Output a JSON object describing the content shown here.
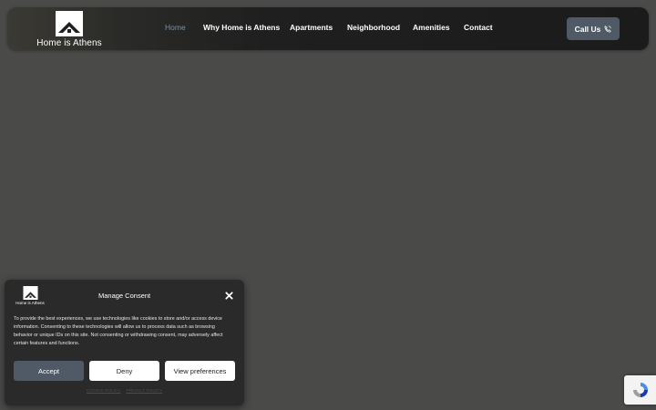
{
  "header": {
    "logo": {
      "icon": "house-logo-icon",
      "text": "Home is Athens"
    },
    "nav": [
      {
        "label": "Home",
        "active": true
      },
      {
        "label": "Why Home is Athens",
        "active": false
      },
      {
        "label": "Apartments",
        "active": false
      },
      {
        "label": "Neighborhood",
        "active": false
      },
      {
        "label": "Amenities",
        "active": false
      },
      {
        "label": "Contact",
        "active": false
      }
    ],
    "call_button": {
      "label": "Call Us",
      "icon": "phone-icon"
    }
  },
  "consent": {
    "logo_text": "Home is Athens",
    "title": "Manage Consent",
    "body": "To provide the best experiences, we use technologies like cookies to store and/or access device information. Consenting to these technologies will allow us to process data such as browsing behavior or unique IDs on this site. Not consenting or withdrawing consent, may adversely affect certain features and functions.",
    "buttons": {
      "accept": "Accept",
      "deny": "Deny",
      "preferences": "View preferences"
    },
    "links": {
      "cookie_policy": "COOKIE POLICY",
      "privacy_policy": "PRIVACY POLICY"
    }
  },
  "colors": {
    "page_bg": "#4a4a49",
    "nav_bg": "#1f1f1f",
    "accent": "#4f5a66",
    "active_nav": "#7b8fa1"
  }
}
